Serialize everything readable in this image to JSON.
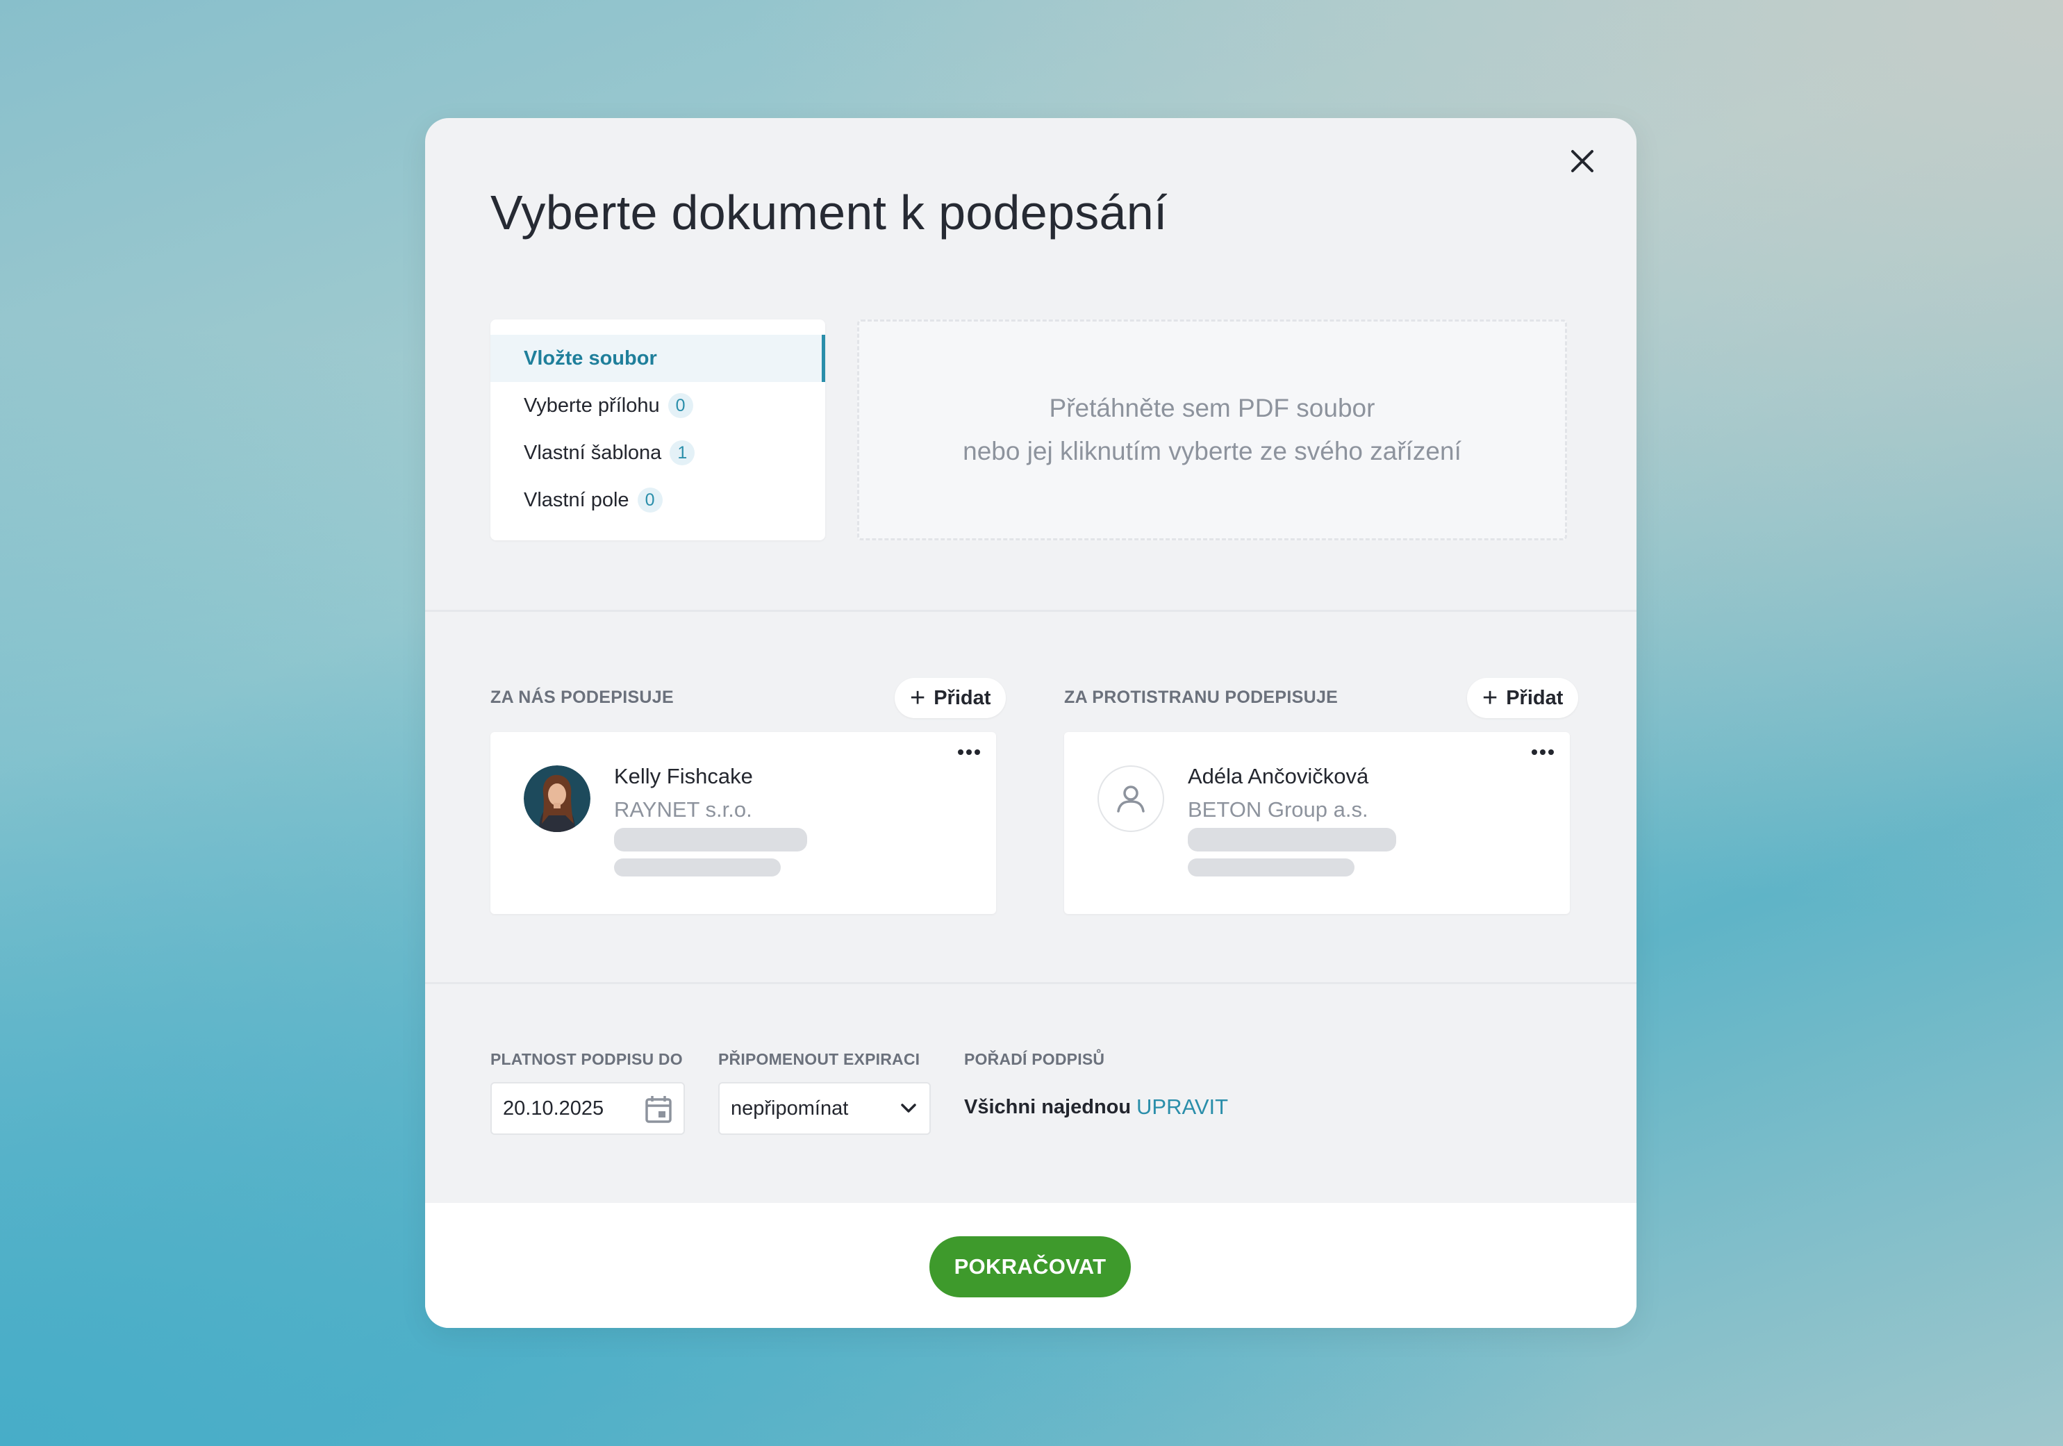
{
  "modal": {
    "title": "Vyberte dokument k podepsání",
    "close_icon": "close-icon"
  },
  "source_tabs": [
    {
      "label": "Vložte soubor",
      "active": true
    },
    {
      "label": "Vyberte přílohu",
      "count": "0"
    },
    {
      "label": "Vlastní šablona",
      "count": "1"
    },
    {
      "label": "Vlastní pole",
      "count": "0"
    }
  ],
  "dropzone": {
    "line1": "Přetáhněte sem PDF soubor",
    "line2": "nebo jej kliknutím vyberte ze svého zařízení"
  },
  "our_signers": {
    "label": "ZA NÁS PODEPISUJE",
    "add_label": "Přidat",
    "signer": {
      "name": "Kelly Fishcake",
      "company": "RAYNET s.r.o.",
      "avatar": "photo"
    }
  },
  "their_signers": {
    "label": "ZA PROTISTRANU PODEPISUJE",
    "add_label": "Přidat",
    "signer": {
      "name": "Adéla Ančovičková",
      "company": "BETON Group a.s.",
      "avatar": "user-icon"
    }
  },
  "settings": {
    "validity_label": "PLATNOST PODPISU DO",
    "validity_value": "20.10.2025",
    "reminder_label": "PŘIPOMENOUT EXPIRACI",
    "reminder_value": "nepřipomínat",
    "order_label": "POŘADÍ PODPISŮ",
    "order_value": "Všichni najednou",
    "order_edit": "UPRAVIT"
  },
  "footer": {
    "continue_label": "POKRAČOVAT"
  },
  "colors": {
    "accent": "#2a8eaa",
    "primary_button": "#3e9a2c",
    "modal_bg": "#f1f2f4"
  }
}
